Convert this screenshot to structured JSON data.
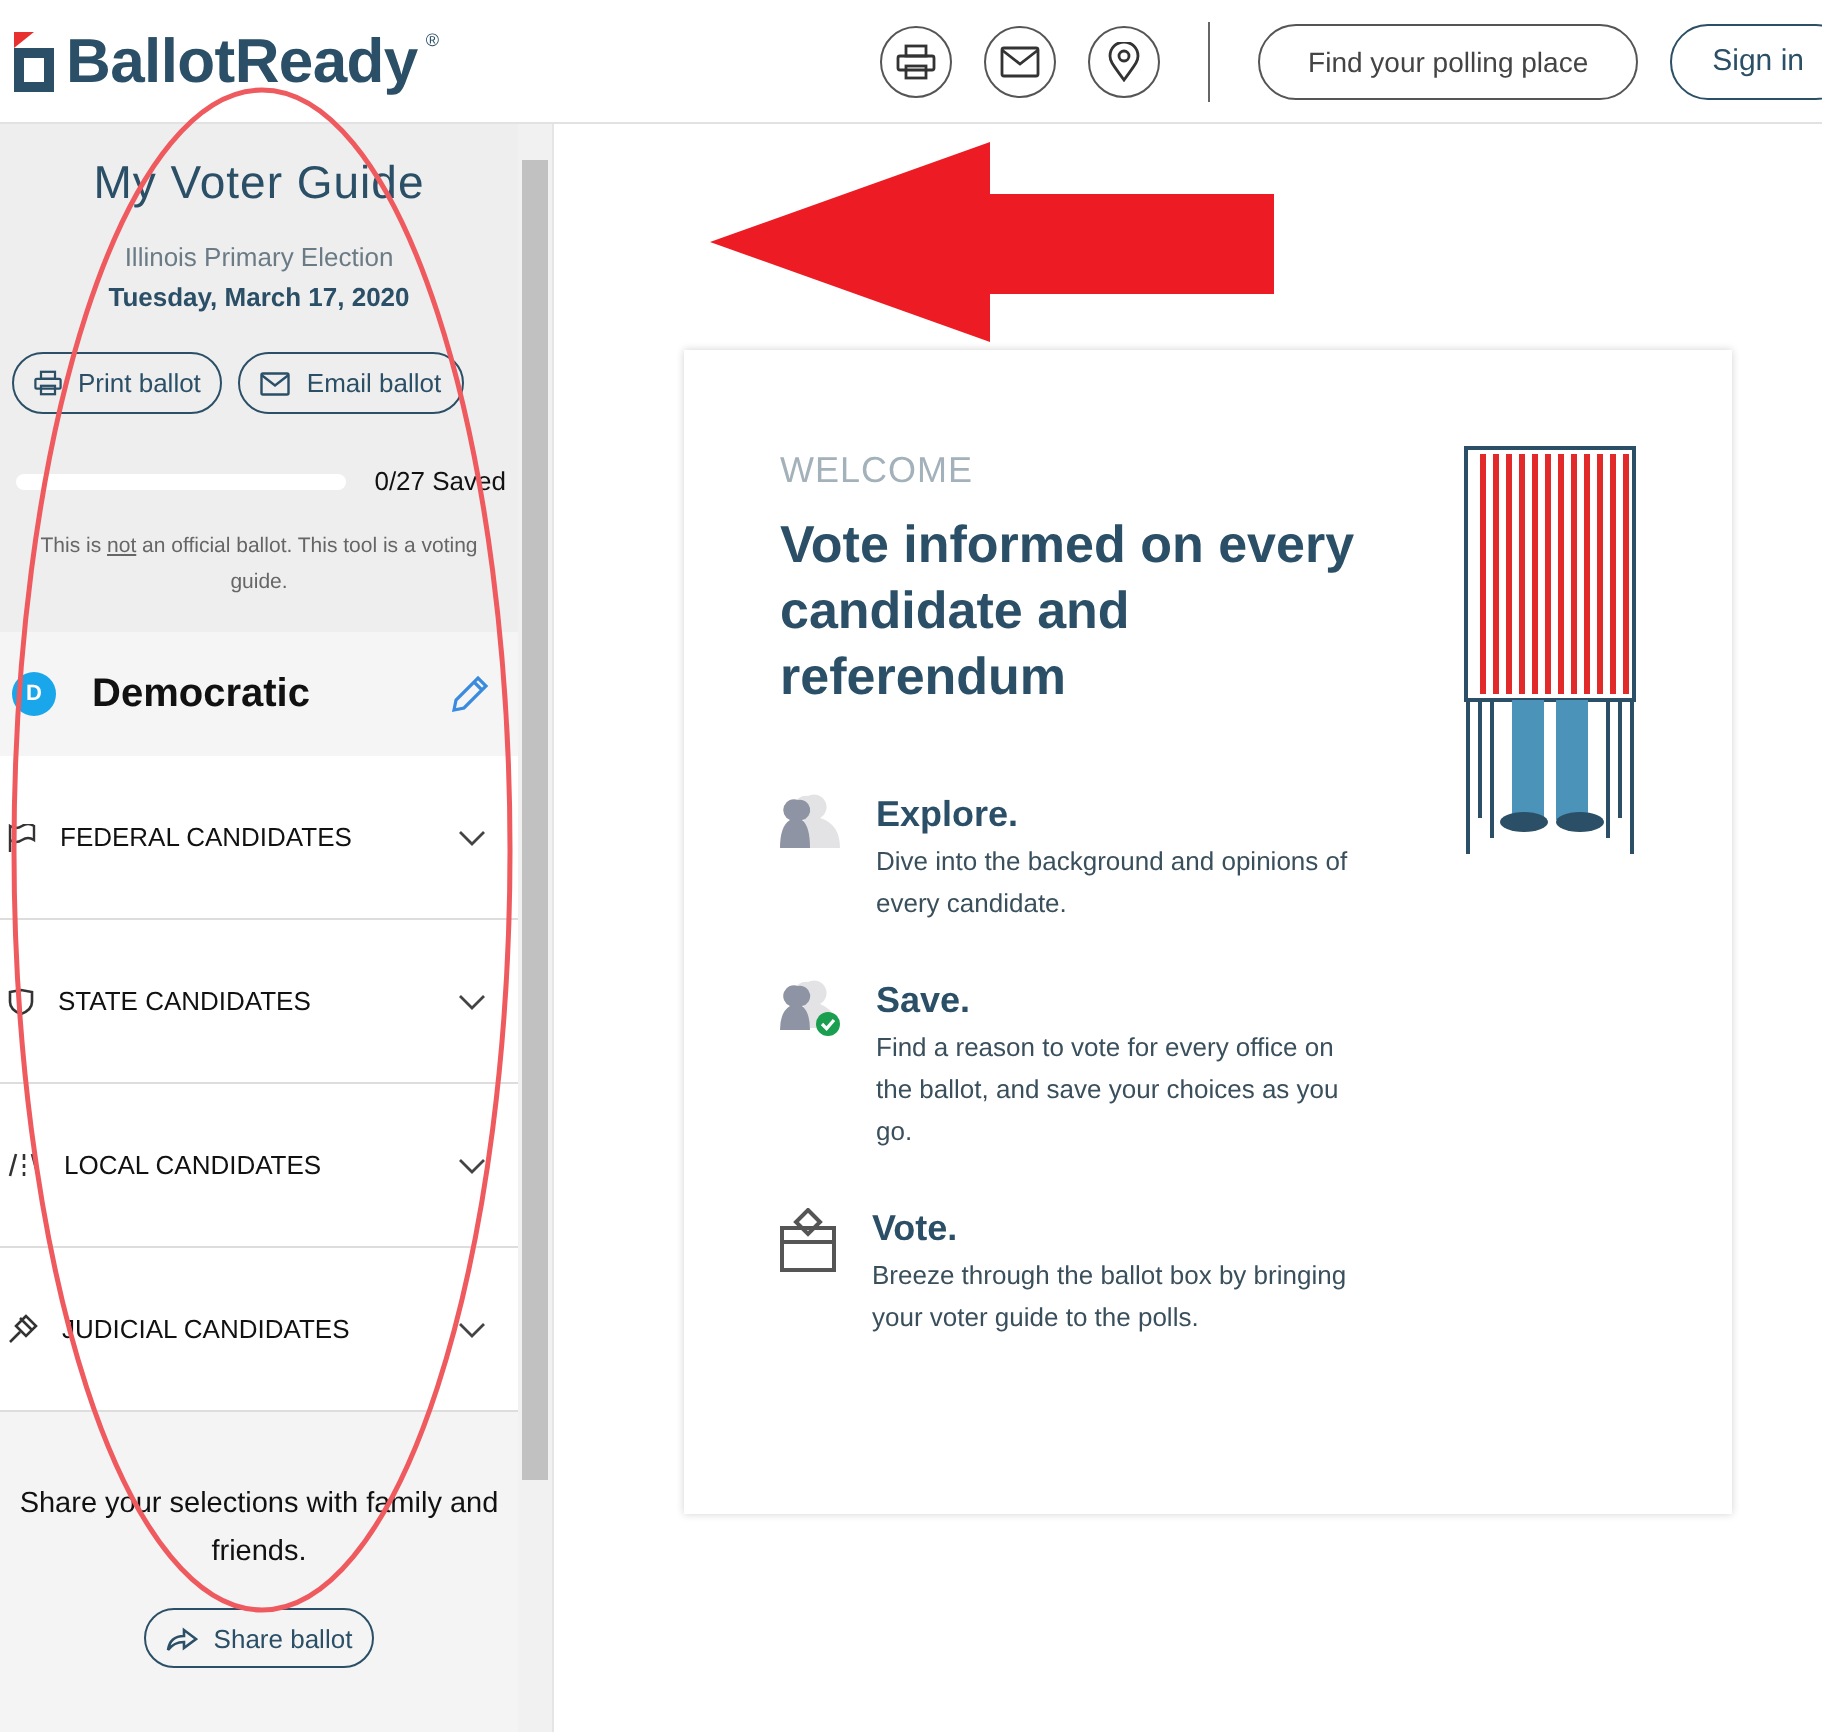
{
  "header": {
    "logo": "BallotReady",
    "logo_mark": "®",
    "icon_buttons": [
      {
        "kind": "print"
      },
      {
        "kind": "email"
      },
      {
        "kind": "location"
      }
    ],
    "find_button": "Find your polling place",
    "sign_in": "Sign in"
  },
  "sidebar": {
    "title": "My Voter Guide",
    "election": "Illinois Primary Election",
    "date": "Tuesday, March 17, 2020",
    "actions": [
      {
        "kind": "print",
        "label": "Print ballot"
      },
      {
        "kind": "email",
        "label": "Email ballot"
      }
    ],
    "progress": {
      "level": 0,
      "reading": "0/27 Saved"
    },
    "note": {
      "before": "This is",
      "underlined": "not",
      "after": "an official ballot. This tool is a voting guide."
    },
    "party": {
      "letter": "D",
      "name": "Democratic",
      "color": "#1aa6ea"
    },
    "sections": [
      {
        "kind": "flag",
        "label": "FEDERAL CANDIDATES",
        "expanded": false
      },
      {
        "kind": "shield",
        "label": "STATE CANDIDATES",
        "expanded": false
      },
      {
        "kind": "road",
        "label": "LOCAL CANDIDATES",
        "expanded": false
      },
      {
        "kind": "gavel",
        "label": "JUDICIAL CANDIDATES",
        "expanded": false
      }
    ],
    "share_text": "Share your selections with family and friends.",
    "share_button": "Share ballot"
  },
  "welcome": {
    "eyebrow": "WELCOME",
    "heading": "Vote informed on every candidate and referendum",
    "steps": [
      {
        "kind": "explore",
        "title": "Explore.",
        "text": "Dive into the background and opinions of every candidate."
      },
      {
        "kind": "save",
        "title": "Save.",
        "text": "Find a reason to vote for every office on the ballot, and save your choices as you go."
      },
      {
        "kind": "vote",
        "title": "Vote.",
        "text": "Breeze through the ballot box by bringing your voter guide to the polls."
      }
    ]
  }
}
